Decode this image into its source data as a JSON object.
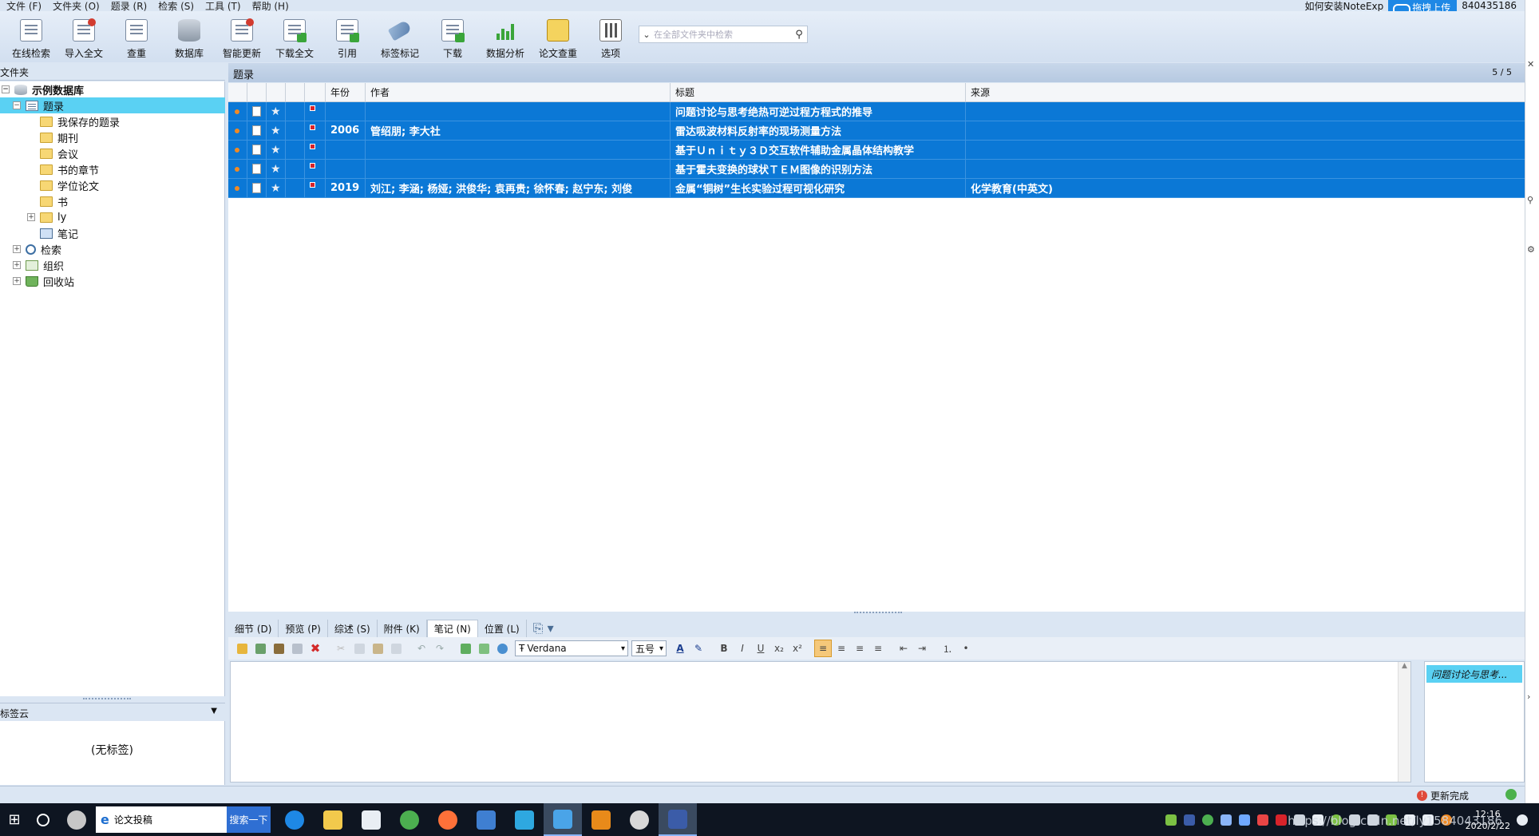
{
  "menubar": {
    "items": [
      "文件 (F)",
      "文件夹 (O)",
      "题录 (R)",
      "检索 (S)",
      "工具 (T)",
      "帮助 (H)"
    ],
    "note_title": "如何安装NoteExp",
    "upload_label": "拖拽上传",
    "user_id": "840435186"
  },
  "toolbar": {
    "buttons": [
      {
        "label": "在线检索",
        "icon": "online-search-icon"
      },
      {
        "label": "导入全文",
        "icon": "import-fulltext-icon"
      },
      {
        "label": "查重",
        "icon": "duplicate-check-icon"
      },
      {
        "label": "数据库",
        "icon": "database-icon"
      },
      {
        "label": "智能更新",
        "icon": "smart-update-icon"
      },
      {
        "label": "下载全文",
        "icon": "download-fulltext-icon"
      },
      {
        "label": "引用",
        "icon": "cite-icon"
      },
      {
        "label": "标签标记",
        "icon": "tag-icon"
      },
      {
        "label": "下载",
        "icon": "download-icon"
      },
      {
        "label": "数据分析",
        "icon": "data-analysis-icon"
      },
      {
        "label": "论文查重",
        "icon": "paper-check-icon"
      },
      {
        "label": "选项",
        "icon": "options-icon"
      }
    ],
    "search_placeholder": "在全部文件夹中检索"
  },
  "left_panel": {
    "header": "文件夹",
    "tree": [
      {
        "label": "示例数据库",
        "bold": true
      },
      {
        "label": "题录",
        "selected": true
      },
      {
        "label": "我保存的题录"
      },
      {
        "label": "期刊"
      },
      {
        "label": "会议"
      },
      {
        "label": "书的章节"
      },
      {
        "label": "学位论文"
      },
      {
        "label": "书"
      },
      {
        "label": "ly"
      },
      {
        "label": "笔记"
      },
      {
        "label": "检索"
      },
      {
        "label": "组织"
      },
      {
        "label": "回收站"
      }
    ],
    "tag_cloud_header": "标签云",
    "tag_cloud_empty": "(无标签)"
  },
  "main": {
    "title": "题录",
    "count": "5 / 5",
    "columns": [
      "年份",
      "作者",
      "标题",
      "来源"
    ],
    "rows": [
      {
        "year": "",
        "author": "",
        "title": "问题讨论与思考绝热可逆过程方程式的推导",
        "source": ""
      },
      {
        "year": "2006",
        "author": "管绍朋; 李大社",
        "title": "雷达吸波材料反射率的现场测量方法",
        "source": ""
      },
      {
        "year": "",
        "author": "",
        "title": "基于Ｕｎｉｔｙ３Ｄ交互软件辅助金属晶体结构教学",
        "source": ""
      },
      {
        "year": "",
        "author": "",
        "title": "基于霍夫变换的球状ＴＥＭ图像的识别方法",
        "source": ""
      },
      {
        "year": "2019",
        "author": "刘江; 李涵; 杨娅; 洪俊华; 袁再贵; 徐怀春; 赵宁东; 刘俊",
        "title": "金属“铜树”生长实验过程可视化研究",
        "source": "化学教育(中英文)"
      }
    ]
  },
  "detail": {
    "tabs": [
      "细节 (D)",
      "预览 (P)",
      "综述 (S)",
      "附件 (K)",
      "笔记 (N)",
      "位置 (L)"
    ],
    "active_tab": "笔记 (N)",
    "font": "Verdana",
    "font_size": "五号",
    "note_item": "问题讨论与思考..."
  },
  "status": {
    "text": "更新完成"
  },
  "taskbar": {
    "search_text": "论文投稿",
    "search_button": "搜索一下",
    "time": "12:16",
    "date": "2020/2/22",
    "watermark": "https://blog.csdn.net/ly1584043186"
  },
  "colors": {
    "accent": "#0b78d6",
    "selected_folder": "#5ad1f3",
    "window_bg": "#dbe6f3"
  }
}
